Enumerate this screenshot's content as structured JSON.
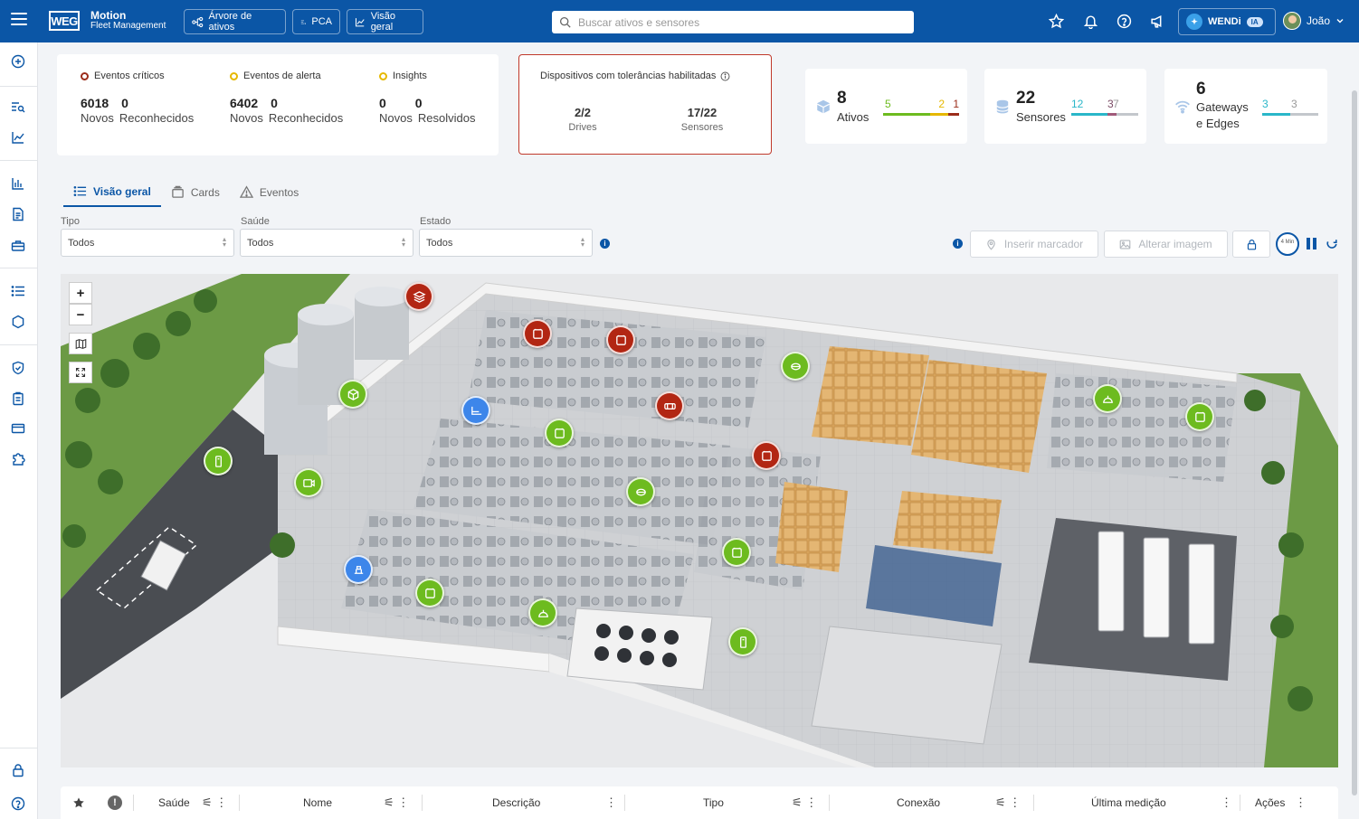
{
  "app": {
    "logo_text": "WEG",
    "title": "Motion",
    "subtitle": "Fleet Management"
  },
  "nav": {
    "asset_tree": "Árvore de ativos",
    "pca": "PCA",
    "overview": "Visão geral"
  },
  "search": {
    "placeholder": "Buscar ativos e sensores"
  },
  "assistant": {
    "label": "WENDi",
    "badge": "IA"
  },
  "user": {
    "name": "João"
  },
  "events": {
    "critical": {
      "label": "Eventos críticos",
      "color": "#9b2c1a",
      "n1": "6018",
      "n2": "0",
      "l1": "Novos",
      "l2": "Reconhecidos"
    },
    "alert": {
      "label": "Eventos de alerta",
      "color": "#e6b800",
      "n1": "6402",
      "n2": "0",
      "l1": "Novos",
      "l2": "Reconhecidos"
    },
    "insights": {
      "label": "Insights",
      "color": "#e6b800",
      "n1": "0",
      "n2": "0",
      "l1": "Novos",
      "l2": "Resolvidos"
    }
  },
  "tolerances": {
    "title": "Dispositivos com tolerâncias habilitadas",
    "drives_value": "2/2",
    "drives_label": "Drives",
    "sensors_value": "17/22",
    "sensors_label": "Sensores"
  },
  "stats": {
    "assets": {
      "value": "8",
      "label": "Ativos",
      "n_green": "5",
      "n_yellow": "2",
      "n_red": "1"
    },
    "sensors": {
      "value": "22",
      "label": "Sensores",
      "n_teal": "12",
      "n_a": "3",
      "n_b": "7"
    },
    "gateways": {
      "value": "6",
      "label_line1": "Gateways",
      "label_line2": "e Edges",
      "n_teal": "3",
      "n_gray": "3"
    }
  },
  "tabs": [
    {
      "label": "Visão geral",
      "icon": "list-icon"
    },
    {
      "label": "Cards",
      "icon": "cards-icon"
    },
    {
      "label": "Eventos",
      "icon": "warning-icon"
    }
  ],
  "filters": {
    "type": {
      "label": "Tipo",
      "value": "Todos"
    },
    "health": {
      "label": "Saúde",
      "value": "Todos"
    },
    "state": {
      "label": "Estado",
      "value": "Todos"
    }
  },
  "actions": {
    "insert_marker": "Inserir marcador",
    "change_image": "Alterar imagem",
    "timer_label": "4 Min"
  },
  "map": {
    "zoom_in": "+",
    "zoom_out": "−",
    "markers": [
      {
        "color": "red",
        "icon": "layers-icon"
      },
      {
        "color": "red",
        "icon": "motor-icon"
      },
      {
        "color": "red",
        "icon": "motor-icon"
      },
      {
        "color": "green",
        "icon": "drive-icon"
      },
      {
        "color": "green",
        "icon": "box-icon"
      },
      {
        "color": "blue",
        "icon": "pump-icon"
      },
      {
        "color": "green",
        "icon": "motor-icon"
      },
      {
        "color": "red",
        "icon": "fan-icon"
      },
      {
        "color": "red",
        "icon": "motor-icon"
      },
      {
        "color": "green",
        "icon": "sensor-icon"
      },
      {
        "color": "green",
        "icon": "gearbox-icon"
      },
      {
        "color": "green",
        "icon": "drive-icon"
      },
      {
        "color": "green",
        "icon": "motor-icon"
      },
      {
        "color": "green",
        "icon": "motor-icon"
      },
      {
        "color": "blue",
        "icon": "plug-icon"
      },
      {
        "color": "green",
        "icon": "motor-icon"
      },
      {
        "color": "green",
        "icon": "fan-icon"
      },
      {
        "color": "green",
        "icon": "sensor-icon"
      },
      {
        "color": "green",
        "icon": "ventilator-icon"
      },
      {
        "color": "green",
        "icon": "motor-icon"
      }
    ]
  },
  "table": {
    "columns": [
      "Saúde",
      "Nome",
      "Descrição",
      "Tipo",
      "Conexão",
      "Última medição",
      "Ações"
    ]
  },
  "colors": {
    "brand_blue": "#0b56a6",
    "healthy_green": "#6dbb1f",
    "critical_red": "#b22613",
    "info_blue": "#3d86ea",
    "teal": "#2ab7c9"
  }
}
